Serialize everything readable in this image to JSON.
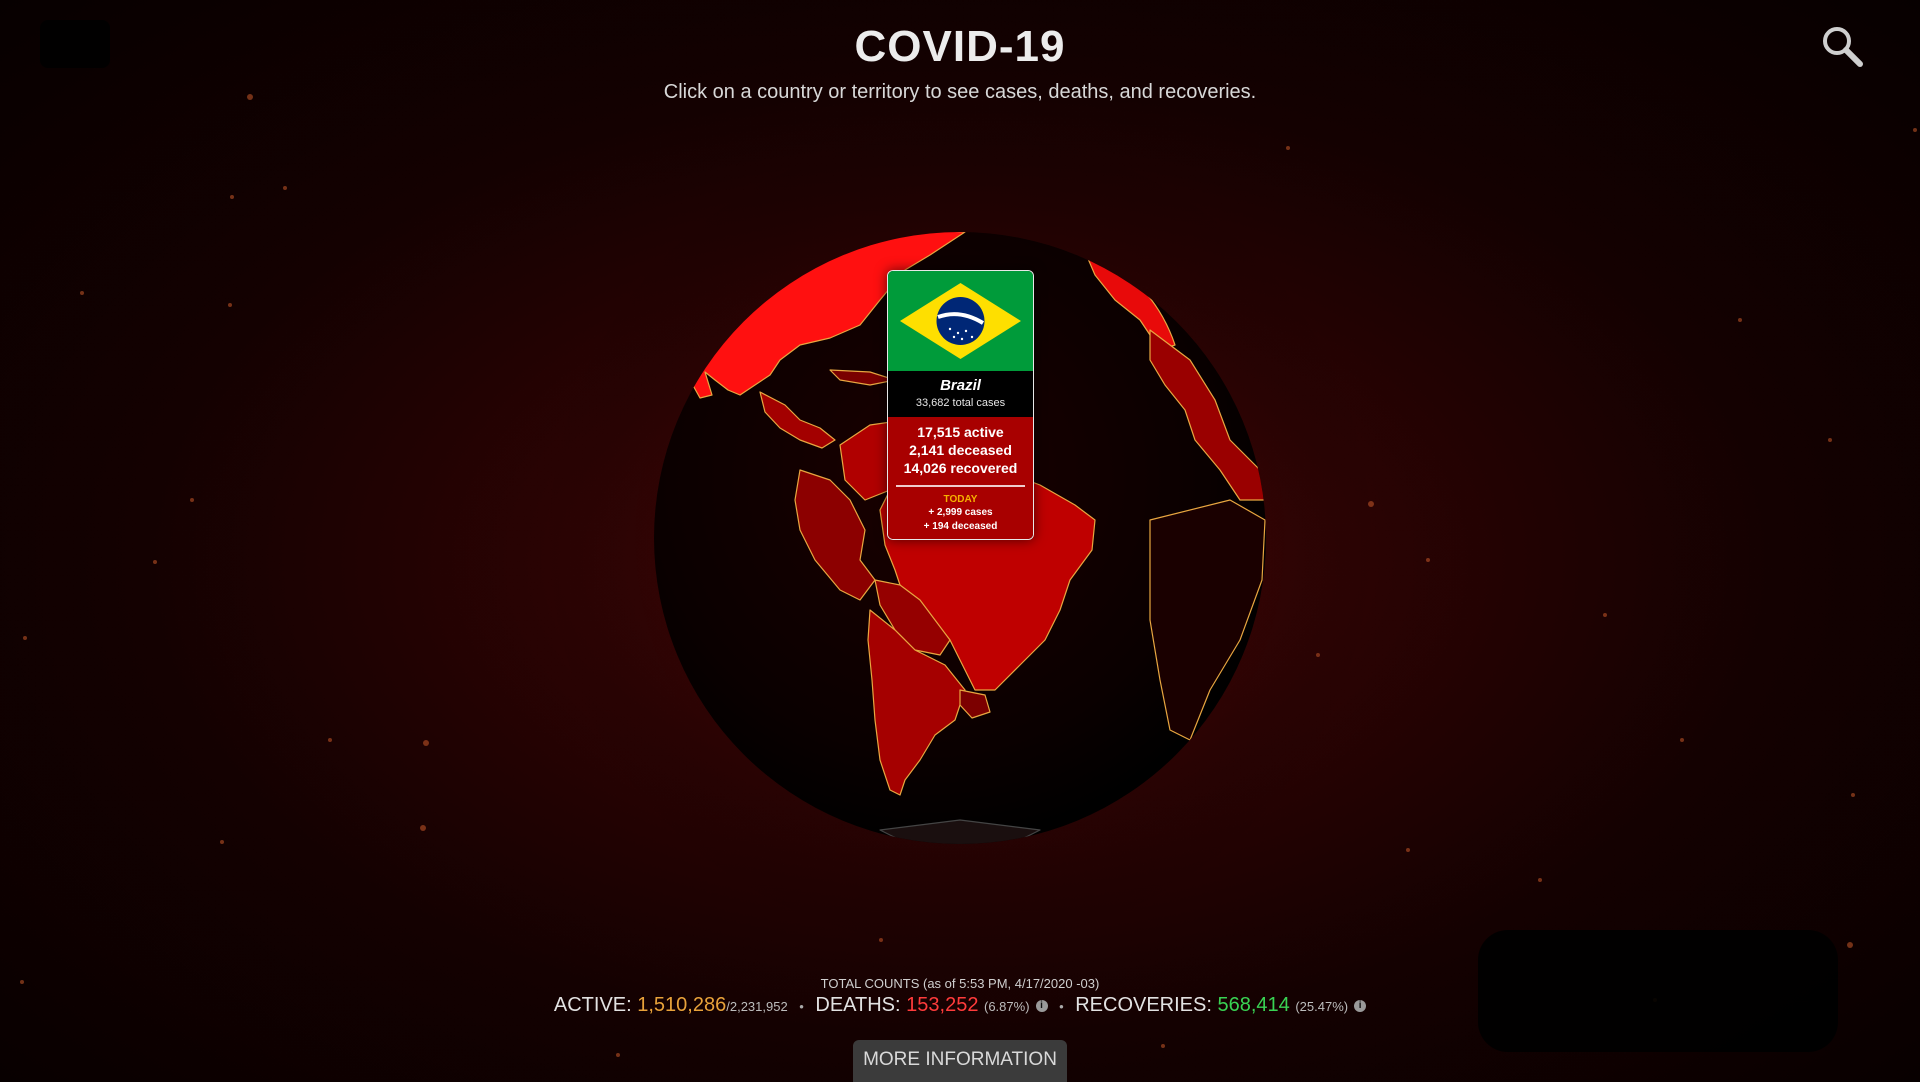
{
  "header": {
    "title": "COVID-19",
    "subtitle": "Click on a country or territory to see cases, deaths, and recoveries."
  },
  "search": {
    "icon": "search-icon"
  },
  "popup": {
    "country": "Brazil",
    "total_cases": "33,682 total cases",
    "active": "17,515 active",
    "deceased": "2,141 deceased",
    "recovered": "14,026 recovered",
    "today_label": "TODAY",
    "today_cases": "+ 2,999 cases",
    "today_deceased": "+ 194 deceased",
    "flag": {
      "green": "#009b3a",
      "yellow": "#fedf00",
      "blue": "#002776"
    }
  },
  "totals": {
    "heading": "TOTAL COUNTS (as of 5:53 PM, 4/17/2020 -03)",
    "active_label": "ACTIVE:",
    "active_value": "1,510,286",
    "active_total": "/2,231,952",
    "deaths_label": "DEATHS:",
    "deaths_value": "153,252",
    "deaths_pct": "(6.87%)",
    "recoveries_label": "RECOVERIES:",
    "recoveries_value": "568,414",
    "recoveries_pct": "(25.47%)",
    "info_glyph": "i"
  },
  "more_button": {
    "label": "MORE INFORMATION"
  },
  "colors": {
    "globe_dark": "#0d0000",
    "infected": "#a30000",
    "infected_bright": "#ff1010",
    "border_line": "#e8a640",
    "active": "#e8a23a",
    "deaths": "#ff3b3b",
    "recoveries": "#39d353"
  }
}
